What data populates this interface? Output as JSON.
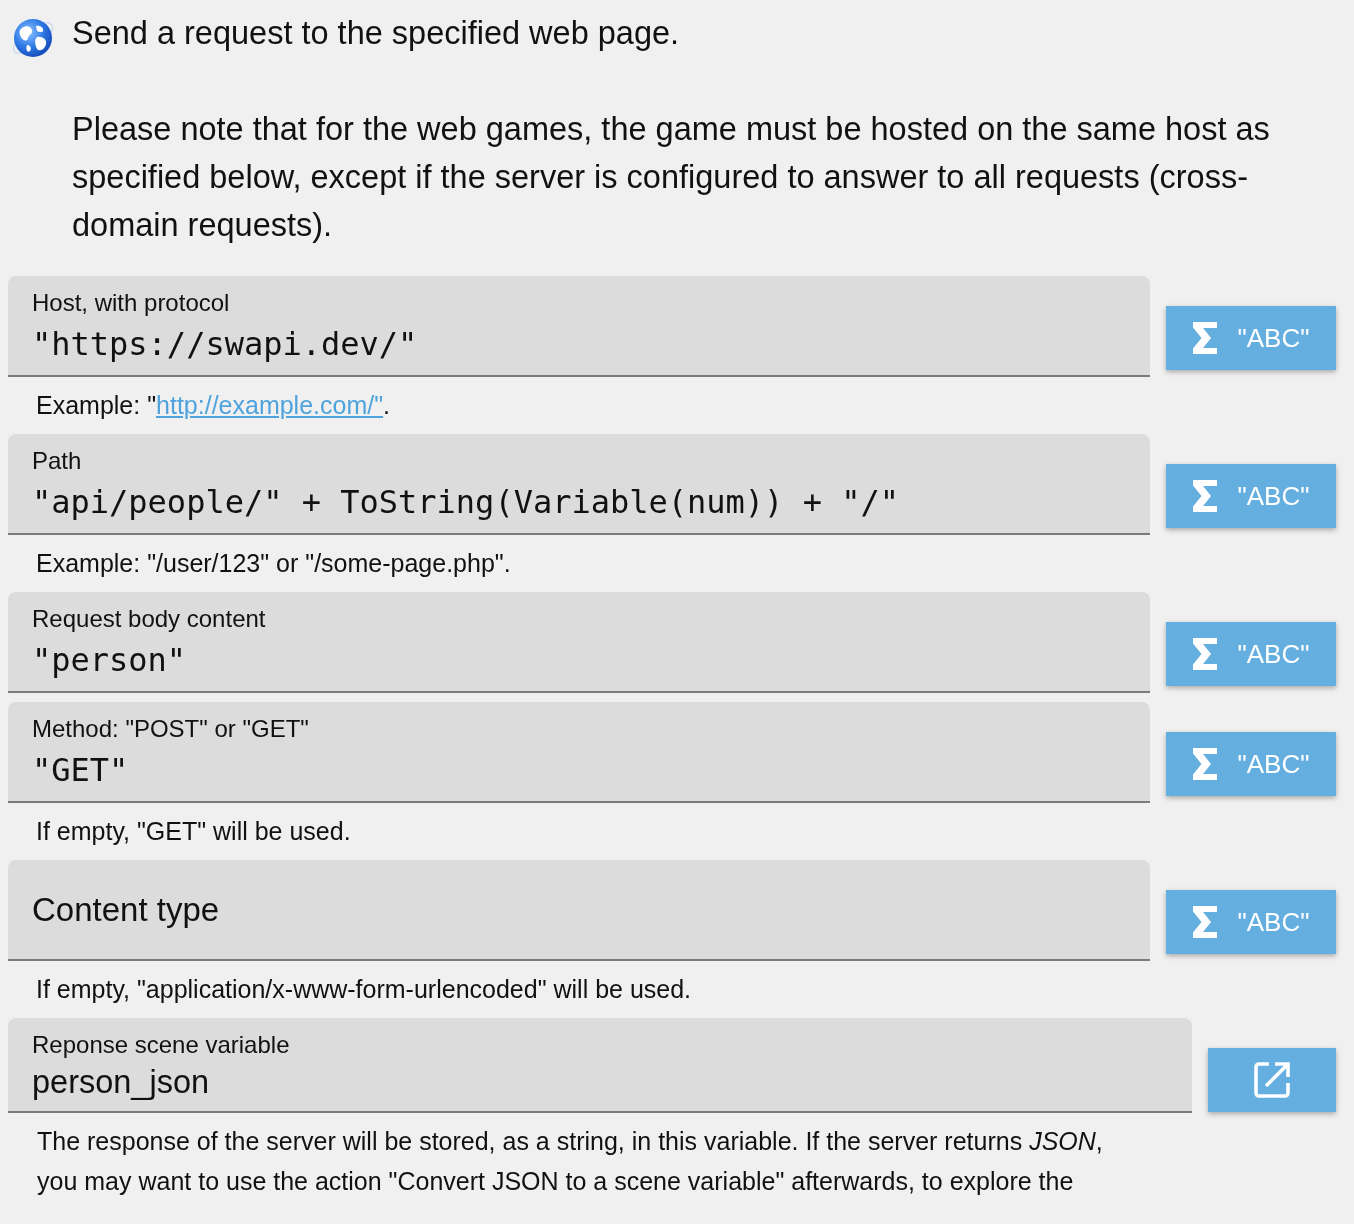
{
  "header": {
    "title": "Send a request to the specified web page.",
    "description": "Please note that for the web games, the game must be hosted on the same host as specified below, except if the server is configured to answer to all requests (cross-domain requests)."
  },
  "fields": [
    {
      "kind": "expression",
      "label": "Host, with protocol",
      "value": "\"https://swapi.dev/\"",
      "button": "\"ABC\"",
      "helper": [
        {
          "kind": "text",
          "text": "Example: \""
        },
        {
          "kind": "link",
          "text": "http://example.com/\""
        },
        {
          "kind": "text",
          "text": "."
        }
      ]
    },
    {
      "kind": "expression",
      "label": "Path",
      "value": "\"api/people/\" + ToString(Variable(num)) + \"/\"",
      "button": "\"ABC\"",
      "helper": [
        {
          "kind": "text",
          "text": "Example: \"/user/123\" or \"/some-page.php\"."
        }
      ]
    },
    {
      "kind": "expression",
      "label": "Request body content",
      "value": "\"person\"",
      "button": "\"ABC\""
    },
    {
      "kind": "expression",
      "label": "Method: \"POST\" or \"GET\"",
      "value": "\"GET\"",
      "button": "\"ABC\"",
      "helper": [
        {
          "kind": "text",
          "text": "If empty, \"GET\" will be used."
        }
      ]
    },
    {
      "kind": "expression",
      "label": "Content type",
      "button": "\"ABC\"",
      "helper": [
        {
          "kind": "text",
          "text": "If empty, \"application/x-www-form-urlencoded\" will be used."
        }
      ]
    },
    {
      "kind": "variable",
      "label": "Reponse scene variable",
      "value": "person_json",
      "helper": [
        {
          "kind": "text",
          "text": "The response of the server will be stored, as a string, in this variable. If the server returns *JSON*, you may want to use the action \"Convert JSON to a scene variable\" afterwards, to explore the"
        }
      ]
    }
  ]
}
